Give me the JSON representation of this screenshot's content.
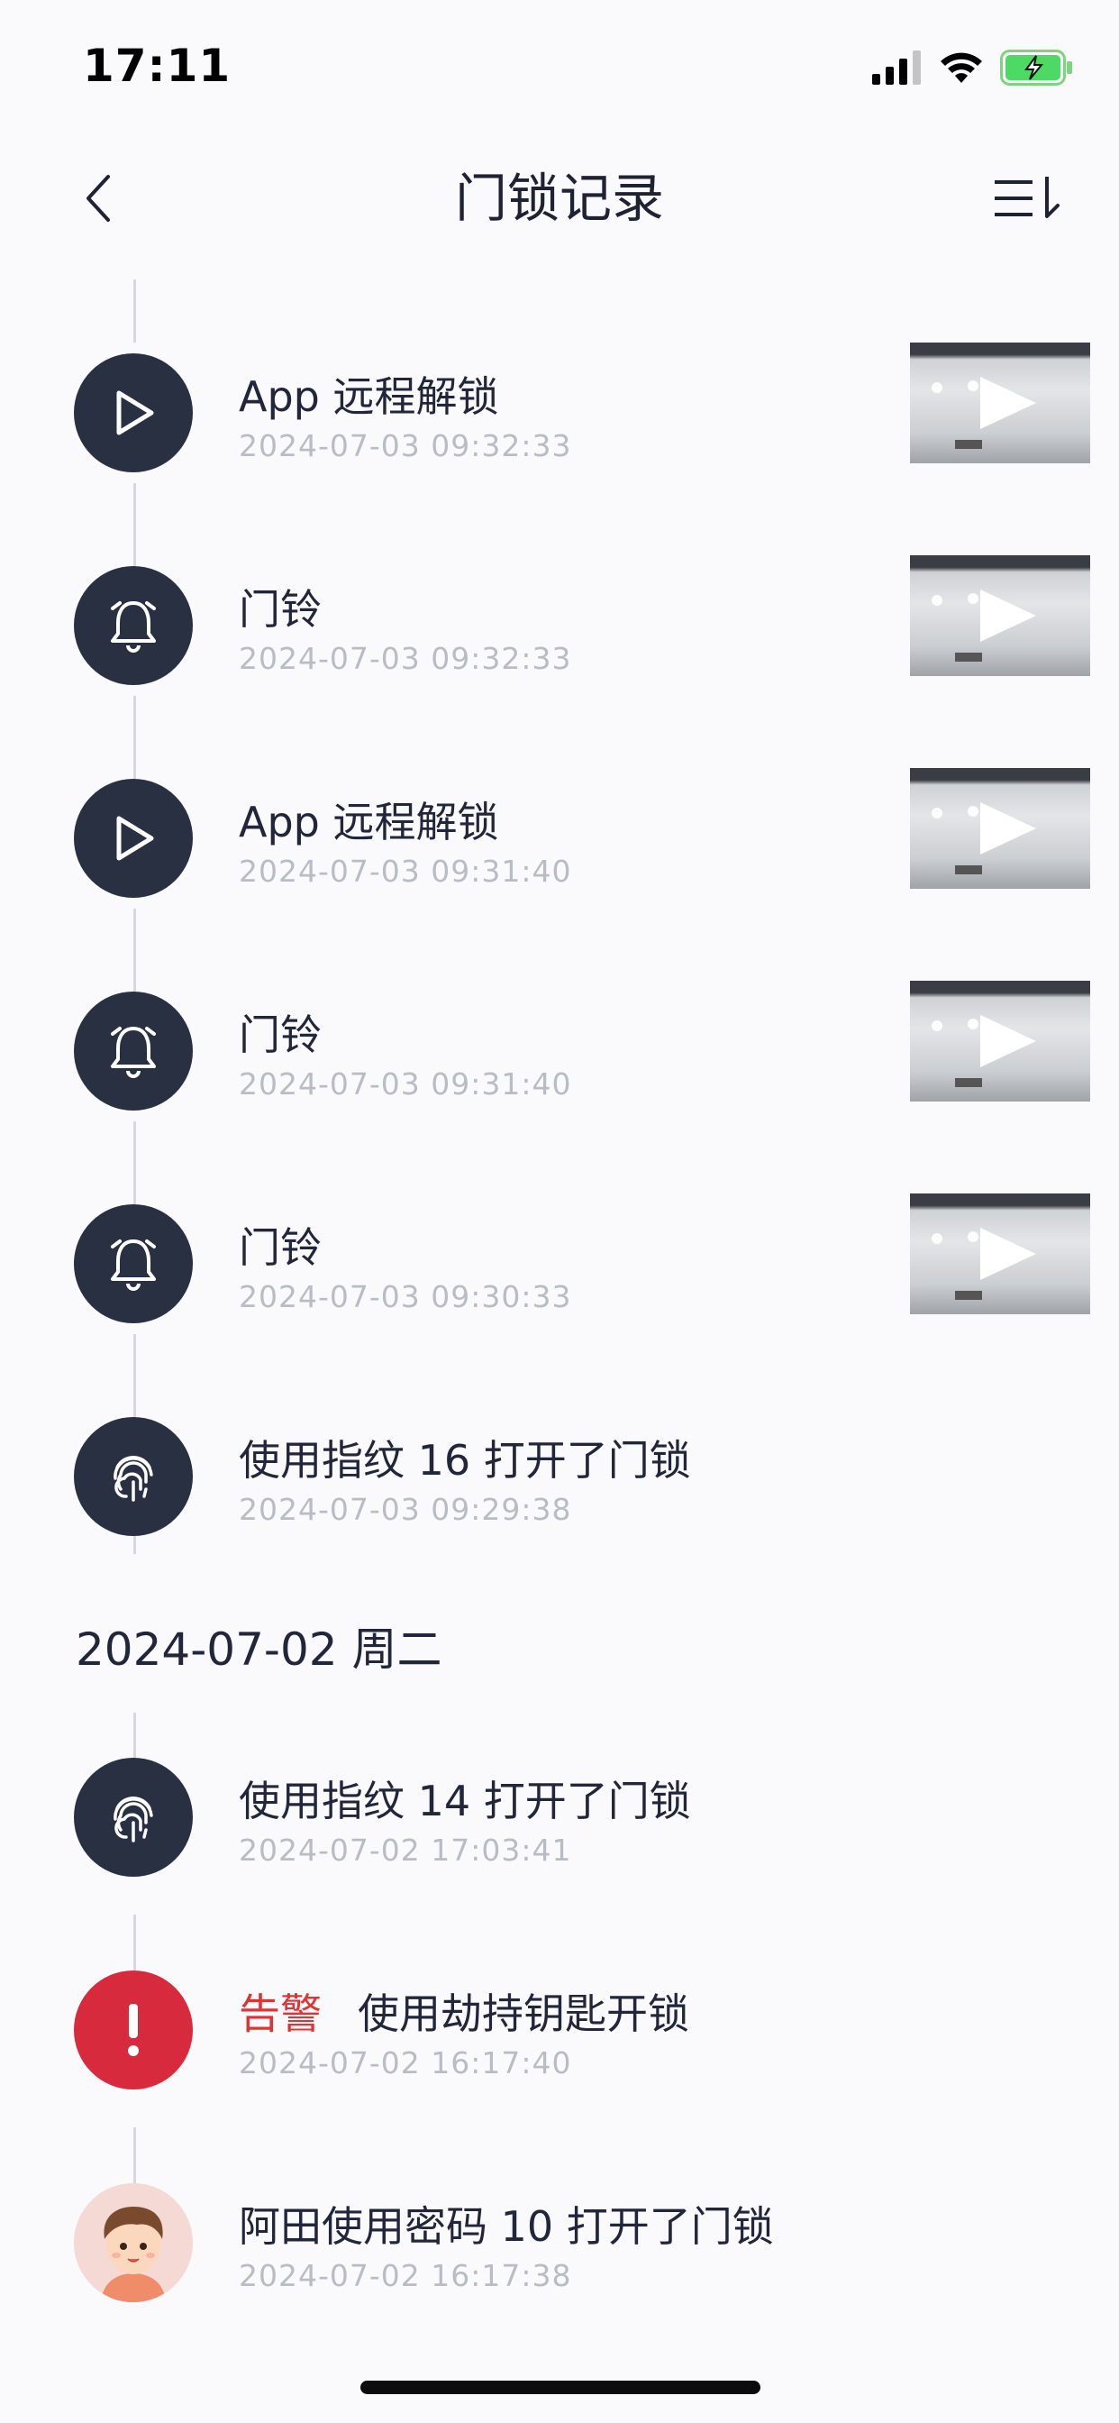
{
  "status_bar": {
    "time": "17:11"
  },
  "nav": {
    "title": "门锁记录"
  },
  "date_header": "2024-07-02 周二",
  "records": [
    {
      "icon": "play-icon",
      "title": "App 远程解锁",
      "time": "2024-07-03 09:32:33",
      "has_thumb": true
    },
    {
      "icon": "bell-icon",
      "title": "门铃",
      "time": "2024-07-03 09:32:33",
      "has_thumb": true
    },
    {
      "icon": "play-icon",
      "title": "App 远程解锁",
      "time": "2024-07-03 09:31:40",
      "has_thumb": true
    },
    {
      "icon": "bell-icon",
      "title": "门铃",
      "time": "2024-07-03 09:31:40",
      "has_thumb": true
    },
    {
      "icon": "bell-icon",
      "title": "门铃",
      "time": "2024-07-03 09:30:33",
      "has_thumb": true
    },
    {
      "icon": "fingerprint-icon",
      "title": "使用指纹 16 打开了门锁",
      "time": "2024-07-03 09:29:38",
      "has_thumb": false
    },
    {
      "icon": "fingerprint-icon",
      "title": "使用指纹 14 打开了门锁",
      "time": "2024-07-02 17:03:41",
      "has_thumb": false
    },
    {
      "icon": "alert-icon",
      "alert_label": "告警",
      "title": "使用劫持钥匙开锁",
      "time": "2024-07-02 16:17:40",
      "has_thumb": false
    },
    {
      "icon": "avatar",
      "title": "阿田使用密码 10 打开了门锁",
      "time": "2024-07-02 16:17:38",
      "has_thumb": false
    }
  ],
  "colors": {
    "icon_bg": "#283042",
    "alert": "#d72a3c",
    "alert_text": "#e03434",
    "battery": "#4cd964"
  }
}
